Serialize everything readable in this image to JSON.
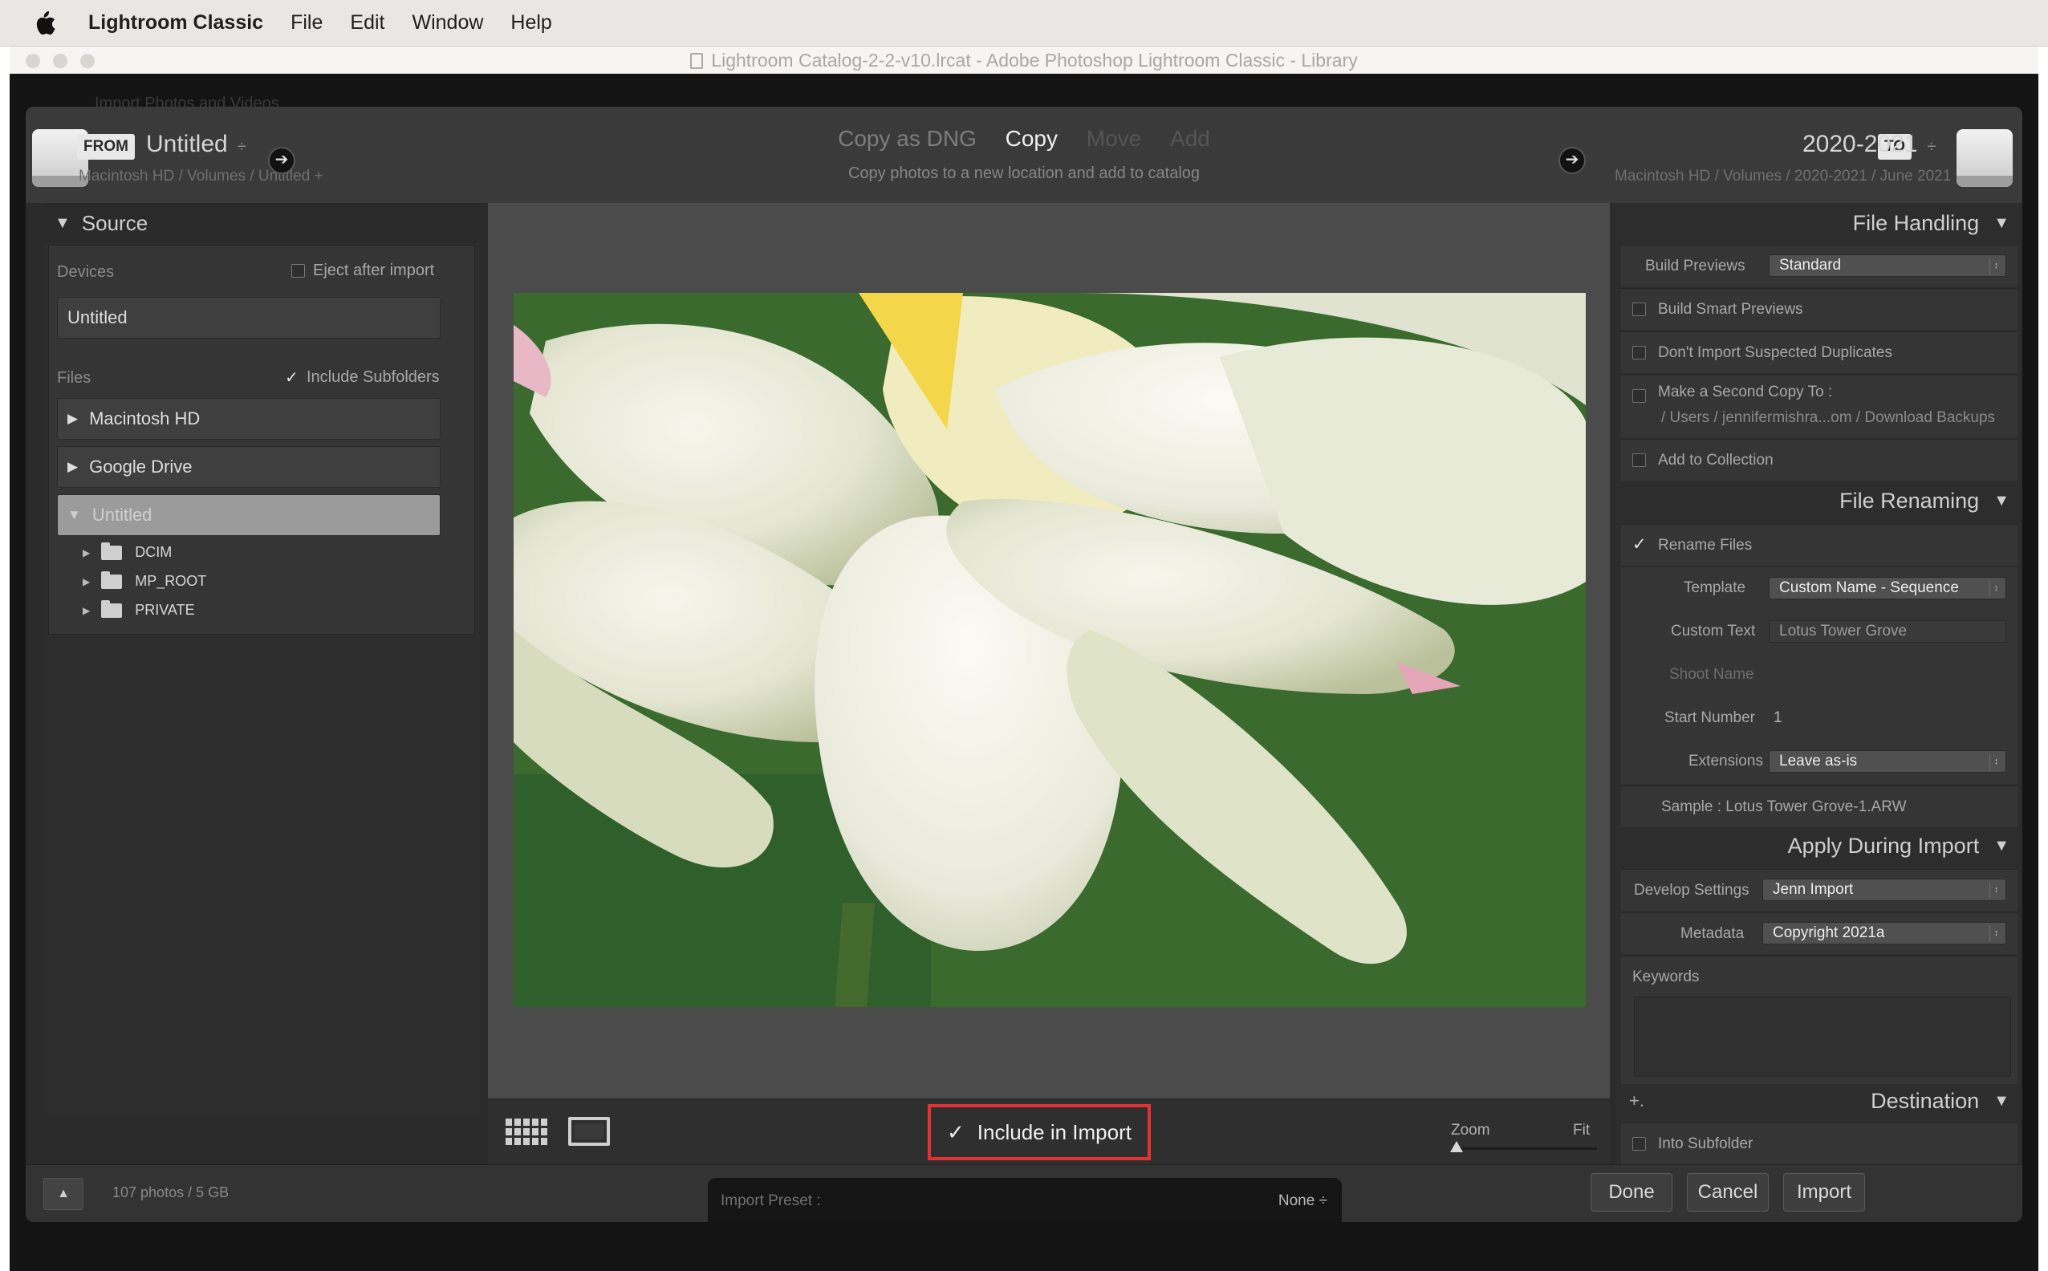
{
  "menubar": {
    "apple": "",
    "items": [
      "Lightroom Classic",
      "File",
      "Edit",
      "Window",
      "Help"
    ]
  },
  "window": {
    "title": "Lightroom Catalog-2-2-v10.lrcat - Adobe Photoshop Lightroom Classic - Library",
    "behind_label": "Import Photos and Videos"
  },
  "topbar": {
    "from_tag": "FROM",
    "from_name": "Untitled",
    "from_path": "Macintosh HD / Volumes / Untitled +",
    "modes": [
      "Copy as DNG",
      "Copy",
      "Move",
      "Add"
    ],
    "active_mode": "Copy",
    "mode_description": "Copy photos to a new location and add to catalog",
    "to_tag": "TO",
    "to_name": "2020-2021",
    "to_path": "Macintosh HD / Volumes / 2020-2021 / June 2021",
    "selector_glyph": "÷"
  },
  "source": {
    "title": "Source",
    "devices_label": "Devices",
    "eject_label": "Eject after import",
    "eject_checked": false,
    "device": "Untitled",
    "files_label": "Files",
    "include_subfolders_label": "Include Subfolders",
    "include_subfolders_checked": true,
    "volumes": [
      "Macintosh HD",
      "Google Drive",
      "Untitled"
    ],
    "selected_volume": "Untitled",
    "folders": [
      "DCIM",
      "MP_ROOT",
      "PRIVATE"
    ]
  },
  "center": {
    "include_in_import": "Include in Import",
    "zoom_label": "Zoom",
    "fit_label": "Fit"
  },
  "file_handling": {
    "title": "File Handling",
    "build_previews_label": "Build Previews",
    "build_previews_value": "Standard",
    "smart_previews": "Build Smart Previews",
    "no_duplicates": "Don't Import Suspected Duplicates",
    "second_copy": "Make a Second Copy To :",
    "second_copy_path": "/ Users / jennifermishra...om / Download Backups",
    "add_collection": "Add to Collection"
  },
  "file_renaming": {
    "title": "File Renaming",
    "rename_files": "Rename Files",
    "rename_checked": true,
    "template_label": "Template",
    "template_value": "Custom Name - Sequence",
    "custom_text_label": "Custom Text",
    "custom_text_value": "Lotus Tower Grove",
    "shoot_name_label": "Shoot Name",
    "start_number_label": "Start Number",
    "start_number_value": "1",
    "extensions_label": "Extensions",
    "extensions_value": "Leave as-is",
    "sample": "Sample :  Lotus Tower Grove-1.ARW"
  },
  "apply_during_import": {
    "title": "Apply During Import",
    "develop_label": "Develop Settings",
    "develop_value": "Jenn Import",
    "metadata_label": "Metadata",
    "metadata_value": "Copyright 2021a",
    "keywords_label": "Keywords"
  },
  "destination": {
    "title": "Destination",
    "plus": "+.",
    "into_subfolder": "Into Subfolder"
  },
  "bottom": {
    "photo_count": "107 photos / 5 GB",
    "preset_label": "Import Preset :",
    "preset_value": "None  ÷",
    "done": "Done",
    "cancel": "Cancel",
    "import": "Import"
  },
  "glyphs": {
    "tri_down": "▼",
    "tri_right": "▶",
    "small_tri_right": "▶",
    "arrow": "➔",
    "check": "✓",
    "spinner": "↕",
    "caret_up": "▲"
  }
}
